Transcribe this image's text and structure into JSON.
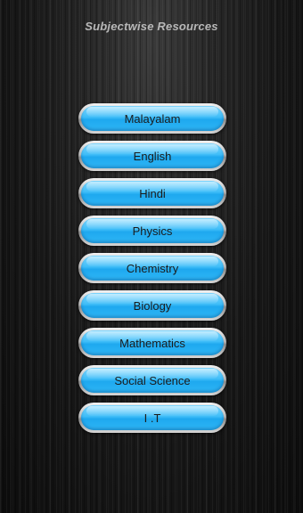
{
  "header": {
    "title": "Subjectwise Resources"
  },
  "subjects": [
    {
      "label": "Malayalam"
    },
    {
      "label": "English"
    },
    {
      "label": "Hindi"
    },
    {
      "label": "Physics"
    },
    {
      "label": "Chemistry"
    },
    {
      "label": "Biology"
    },
    {
      "label": "Mathematics"
    },
    {
      "label": "Social Science"
    },
    {
      "label": "I .T"
    }
  ],
  "colors": {
    "button_face": "#3fbdf8",
    "button_rim": "#c8c8c8",
    "background": "#171717",
    "title_text": "#b8b8b8",
    "label_text": "#1b1b1b"
  }
}
